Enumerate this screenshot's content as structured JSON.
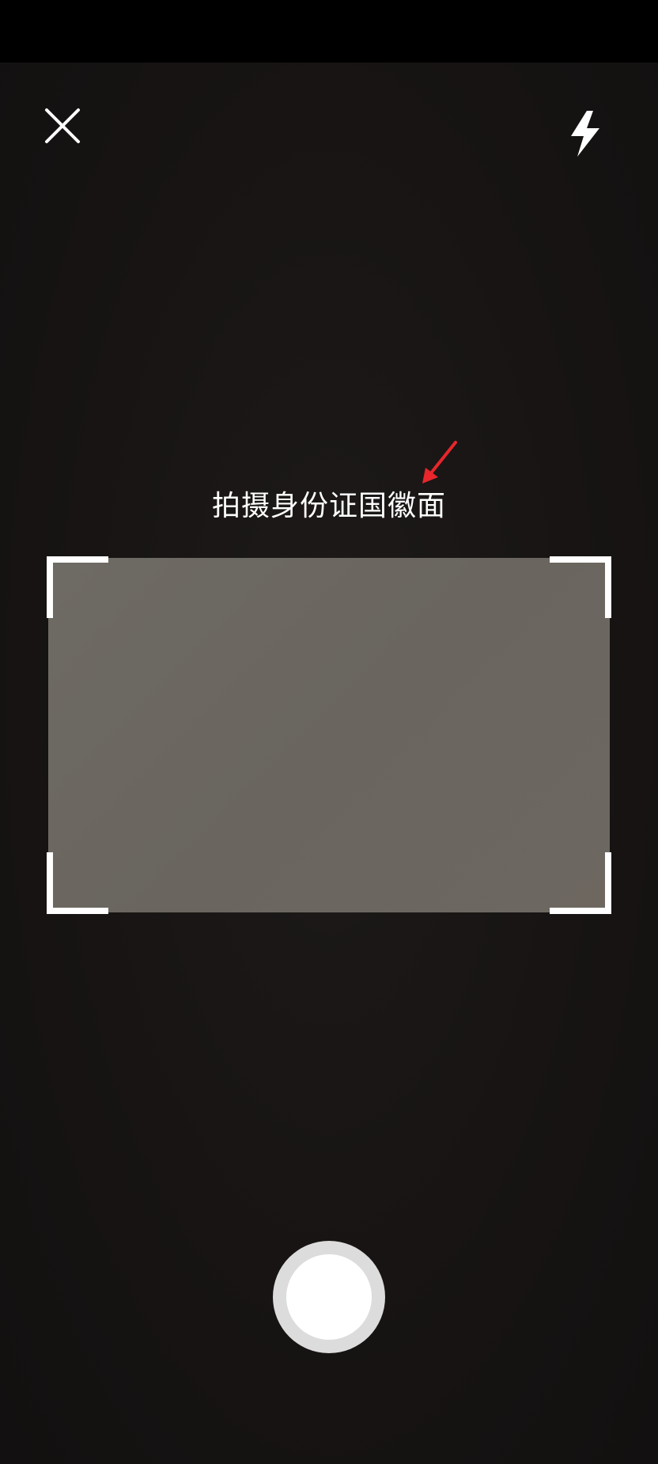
{
  "header": {
    "close_icon": "close-icon",
    "flash_icon": "flash-icon"
  },
  "prompt": {
    "text": "拍摄身份证国徽面"
  },
  "annotation": {
    "icon": "arrow-icon",
    "color": "#e8262b"
  },
  "scan_frame": {
    "corner_color": "#ffffff",
    "fill_color": "#6c6862"
  },
  "shutter": {
    "icon": "shutter-button",
    "ring_color": "#dcdcdc",
    "inner_color": "#ffffff"
  }
}
